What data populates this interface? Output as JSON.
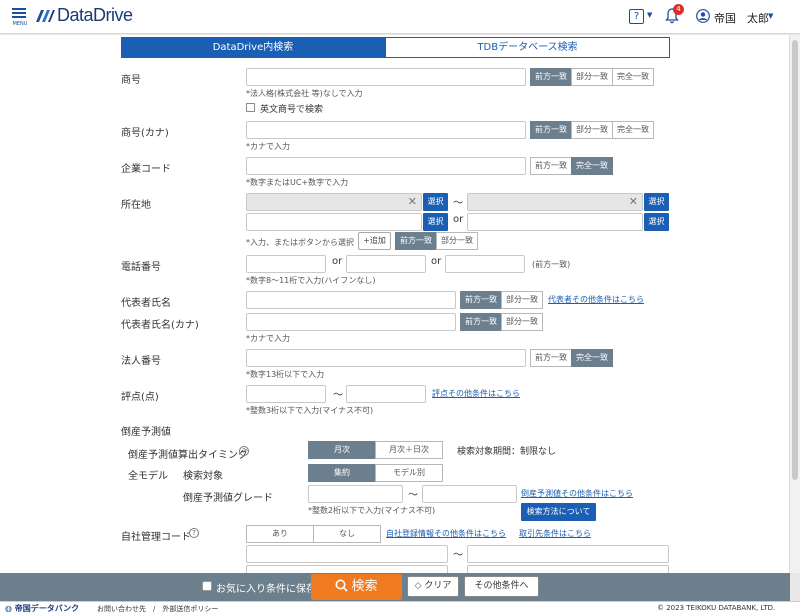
{
  "header": {
    "menu_label": "MENU",
    "logo_text": "DataDrive",
    "help_label": "?",
    "notification_count": "4",
    "user_name": "帝国　太郎",
    "brand_color": "#1a4fa0"
  },
  "tabs": [
    {
      "label": "DataDrive内検索",
      "active": true
    },
    {
      "label": "TDBデータベース検索",
      "active": false
    }
  ],
  "match_modes": {
    "prefix": "前方一致",
    "partial": "部分一致",
    "exact": "完全一致"
  },
  "form": {
    "trade_name": {
      "label": "商号",
      "hint": "*法人格(株式会社 等)なしで入力",
      "english_label": "英文商号で検索",
      "value": ""
    },
    "trade_name_kana": {
      "label": "商号(カナ)",
      "hint": "*カナで入力",
      "value": ""
    },
    "company_code": {
      "label": "企業コード",
      "hint": "*数字またはUC+数字で入力",
      "value": ""
    },
    "address": {
      "label": "所在地",
      "select_label": "選択",
      "tilde": "〜",
      "or": "or",
      "hint": "*入力、またはボタンから選択",
      "add_label": "+追加"
    },
    "phone": {
      "label": "電話番号",
      "or": "or",
      "note": "(前方一致)",
      "hint": "*数字8～11桁で入力(ハイフンなし)"
    },
    "rep_name": {
      "label": "代表者氏名",
      "link": "代表者その他条件はこちら"
    },
    "rep_name_kana": {
      "label": "代表者氏名(カナ)",
      "hint": "*カナで入力"
    },
    "corp_number": {
      "label": "法人番号",
      "hint": "*数字13桁以下で入力"
    },
    "score": {
      "label": "評点(点)",
      "tilde": "〜",
      "link": "評点その他条件はこちら",
      "hint": "*整数3桁以下で入力(マイナス不可)"
    },
    "bankruptcy": {
      "section_label": "倒産予測値",
      "timing_label": "倒産予測値算出タイミング",
      "timing_options": [
        "月次",
        "月次＋日次"
      ],
      "period_text": "検索対象期間：制限なし",
      "model_label": "全モデル",
      "target_label": "検索対象",
      "target_options": [
        "集約",
        "モデル別"
      ],
      "grade_label": "倒産予測値グレード",
      "tilde": "〜",
      "grade_link": "倒産予測値その他条件はこちら",
      "grade_hint": "*整数2桁以下で入力(マイナス不可)",
      "method_button": "検索方法について"
    },
    "own_code": {
      "label": "自社管理コード",
      "options": [
        "あり",
        "なし"
      ],
      "link1": "自社登録情報その他条件はこちら",
      "link2": "取引先条件はこちら",
      "tilde": "〜"
    }
  },
  "action_bar": {
    "favorite_label": "お気に入り条件に保存",
    "search_label": "検索",
    "clear_label": "クリア",
    "other_label": "その他条件へ",
    "search_color": "#f07a22"
  },
  "footer": {
    "logo_text": "帝国データバンク",
    "links": "お問い合わせ先　/　外部送信ポリシー",
    "copyright": "© 2023 TEIKOKU DATABANK, LTD."
  }
}
